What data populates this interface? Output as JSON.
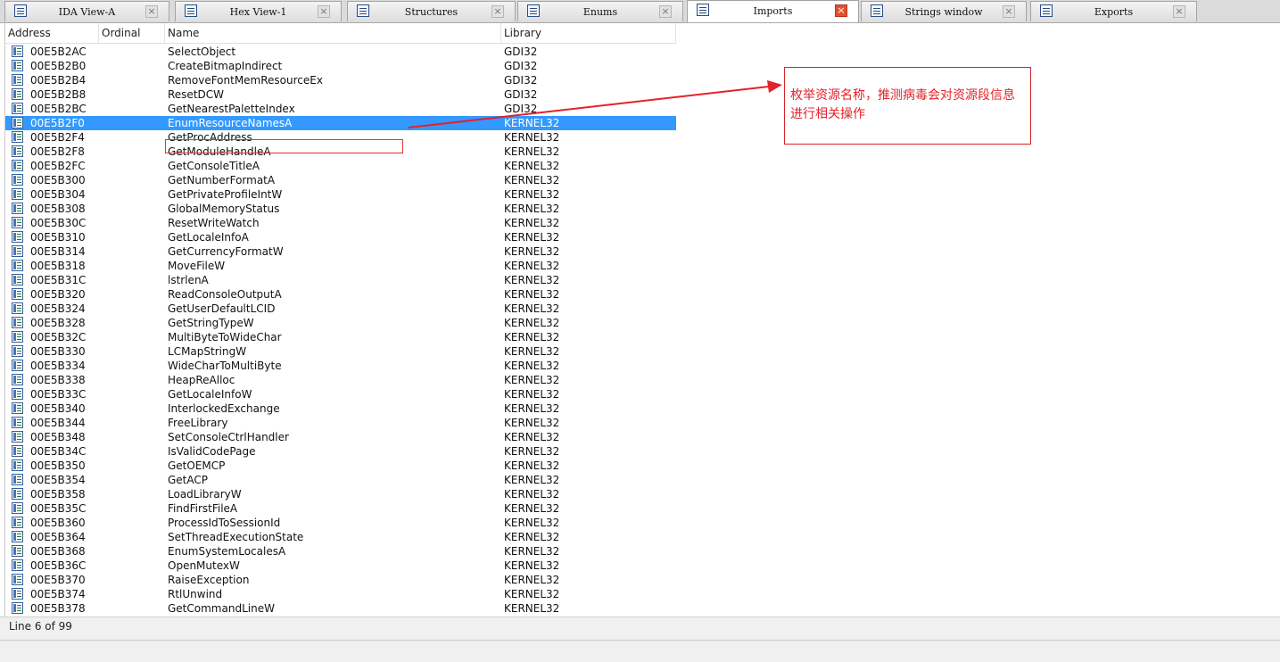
{
  "tabs": [
    {
      "label": "IDA View-A",
      "icon": "ida-view-icon",
      "active": false
    },
    {
      "label": "Hex View-1",
      "icon": "hex-view-icon",
      "active": false
    },
    {
      "label": "Structures",
      "icon": "structures-icon",
      "active": false
    },
    {
      "label": "Enums",
      "icon": "enums-icon",
      "active": false
    },
    {
      "label": "Imports",
      "icon": "imports-icon",
      "active": true
    },
    {
      "label": "Strings window",
      "icon": "strings-icon",
      "active": false
    },
    {
      "label": "Exports",
      "icon": "exports-icon",
      "active": false
    }
  ],
  "columns": {
    "address": "Address",
    "ordinal": "Ordinal",
    "name": "Name",
    "library": "Library"
  },
  "selected_row_index": 5,
  "rows": [
    {
      "address": "00E5B2AC",
      "name": "SelectObject",
      "library": "GDI32"
    },
    {
      "address": "00E5B2B0",
      "name": "CreateBitmapIndirect",
      "library": "GDI32"
    },
    {
      "address": "00E5B2B4",
      "name": "RemoveFontMemResourceEx",
      "library": "GDI32"
    },
    {
      "address": "00E5B2B8",
      "name": "ResetDCW",
      "library": "GDI32"
    },
    {
      "address": "00E5B2BC",
      "name": "GetNearestPaletteIndex",
      "library": "GDI32"
    },
    {
      "address": "00E5B2F0",
      "name": "EnumResourceNamesA",
      "library": "KERNEL32"
    },
    {
      "address": "00E5B2F4",
      "name": "GetProcAddress",
      "library": "KERNEL32"
    },
    {
      "address": "00E5B2F8",
      "name": "GetModuleHandleA",
      "library": "KERNEL32"
    },
    {
      "address": "00E5B2FC",
      "name": "GetConsoleTitleA",
      "library": "KERNEL32"
    },
    {
      "address": "00E5B300",
      "name": "GetNumberFormatA",
      "library": "KERNEL32"
    },
    {
      "address": "00E5B304",
      "name": "GetPrivateProfileIntW",
      "library": "KERNEL32"
    },
    {
      "address": "00E5B308",
      "name": "GlobalMemoryStatus",
      "library": "KERNEL32"
    },
    {
      "address": "00E5B30C",
      "name": "ResetWriteWatch",
      "library": "KERNEL32"
    },
    {
      "address": "00E5B310",
      "name": "GetLocaleInfoA",
      "library": "KERNEL32"
    },
    {
      "address": "00E5B314",
      "name": "GetCurrencyFormatW",
      "library": "KERNEL32"
    },
    {
      "address": "00E5B318",
      "name": "MoveFileW",
      "library": "KERNEL32"
    },
    {
      "address": "00E5B31C",
      "name": "lstrlenA",
      "library": "KERNEL32"
    },
    {
      "address": "00E5B320",
      "name": "ReadConsoleOutputA",
      "library": "KERNEL32"
    },
    {
      "address": "00E5B324",
      "name": "GetUserDefaultLCID",
      "library": "KERNEL32"
    },
    {
      "address": "00E5B328",
      "name": "GetStringTypeW",
      "library": "KERNEL32"
    },
    {
      "address": "00E5B32C",
      "name": "MultiByteToWideChar",
      "library": "KERNEL32"
    },
    {
      "address": "00E5B330",
      "name": "LCMapStringW",
      "library": "KERNEL32"
    },
    {
      "address": "00E5B334",
      "name": "WideCharToMultiByte",
      "library": "KERNEL32"
    },
    {
      "address": "00E5B338",
      "name": "HeapReAlloc",
      "library": "KERNEL32"
    },
    {
      "address": "00E5B33C",
      "name": "GetLocaleInfoW",
      "library": "KERNEL32"
    },
    {
      "address": "00E5B340",
      "name": "InterlockedExchange",
      "library": "KERNEL32"
    },
    {
      "address": "00E5B344",
      "name": "FreeLibrary",
      "library": "KERNEL32"
    },
    {
      "address": "00E5B348",
      "name": "SetConsoleCtrlHandler",
      "library": "KERNEL32"
    },
    {
      "address": "00E5B34C",
      "name": "IsValidCodePage",
      "library": "KERNEL32"
    },
    {
      "address": "00E5B350",
      "name": "GetOEMCP",
      "library": "KERNEL32"
    },
    {
      "address": "00E5B354",
      "name": "GetACP",
      "library": "KERNEL32"
    },
    {
      "address": "00E5B358",
      "name": "LoadLibraryW",
      "library": "KERNEL32"
    },
    {
      "address": "00E5B35C",
      "name": "FindFirstFileA",
      "library": "KERNEL32"
    },
    {
      "address": "00E5B360",
      "name": "ProcessIdToSessionId",
      "library": "KERNEL32"
    },
    {
      "address": "00E5B364",
      "name": "SetThreadExecutionState",
      "library": "KERNEL32"
    },
    {
      "address": "00E5B368",
      "name": "EnumSystemLocalesA",
      "library": "KERNEL32"
    },
    {
      "address": "00E5B36C",
      "name": "OpenMutexW",
      "library": "KERNEL32"
    },
    {
      "address": "00E5B370",
      "name": "RaiseException",
      "library": "KERNEL32"
    },
    {
      "address": "00E5B374",
      "name": "RtlUnwind",
      "library": "KERNEL32"
    },
    {
      "address": "00E5B378",
      "name": "GetCommandLineW",
      "library": "KERNEL32"
    }
  ],
  "annotation": {
    "text": "枚举资源名称，推测病毒会对资源段信息进行相关操作",
    "color": "#e3222a"
  },
  "status": {
    "text": "Line 6 of 99"
  },
  "colors": {
    "selection": "#3399ff",
    "annotation_border": "#d3252b"
  }
}
